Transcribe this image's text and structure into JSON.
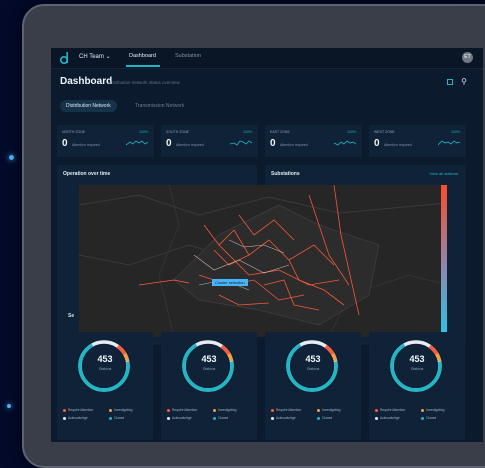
{
  "app": {
    "team_name": "CH Team",
    "team_caret": "⌄",
    "avatar_initials": "ET",
    "nav_tabs": [
      "Dashboard",
      "Substation"
    ]
  },
  "page": {
    "title": "Dashboard",
    "subtitle": "Distribution network status overview",
    "tabs": [
      "Distribution Network",
      "Transmission Network"
    ]
  },
  "zones": [
    {
      "name": "NORTH ZONE",
      "value": "0",
      "sub": "Attention required",
      "pct": "100%"
    },
    {
      "name": "SOUTH ZONE",
      "value": "0",
      "sub": "Attention required",
      "pct": "100%"
    },
    {
      "name": "EAST ZONE",
      "value": "0",
      "sub": "Attention required",
      "pct": "100%"
    },
    {
      "name": "WEST ZONE",
      "value": "0",
      "sub": "Attention required",
      "pct": "100%"
    }
  ],
  "panels": {
    "operation": "Operation over time",
    "substations": "Substations",
    "view_all": "View all stations",
    "section": "Se"
  },
  "map": {
    "label": "Cluster selection"
  },
  "gauges": [
    {
      "value": "453",
      "label": "Stations"
    },
    {
      "value": "453",
      "label": "Stations"
    },
    {
      "value": "453",
      "label": "Stations"
    },
    {
      "value": "453",
      "label": "Stations"
    }
  ],
  "legend": [
    "Require Attention",
    "Investigating",
    "Acknowledge",
    "Closed"
  ],
  "colors": {
    "accent": "#1fb7c5",
    "alert": "#ff5a3a",
    "warn": "#f0a24a",
    "track": "#e6ecf2"
  }
}
